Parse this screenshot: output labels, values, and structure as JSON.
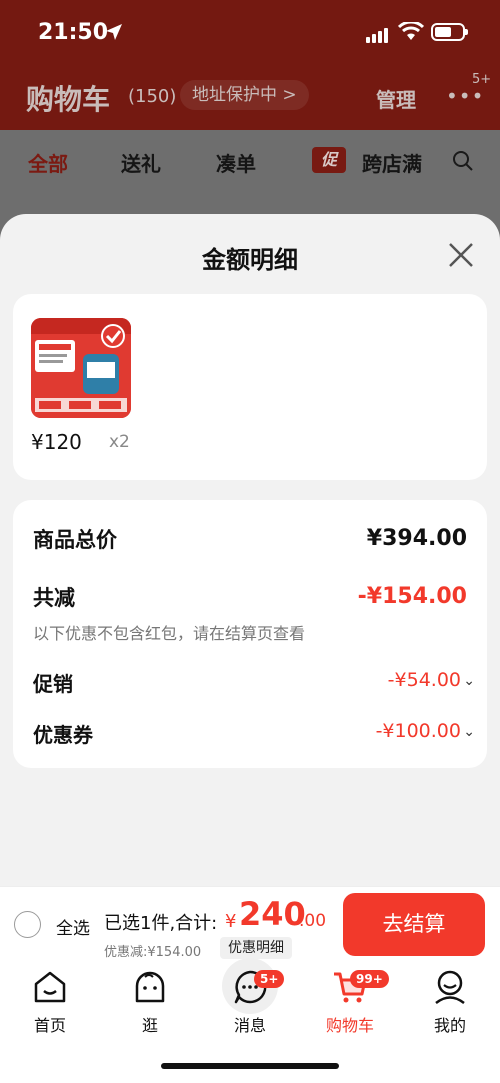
{
  "status_bar": {
    "time": "21:50"
  },
  "header": {
    "title": "购物车",
    "count": "(150)",
    "address_protect": "地址保护中 >",
    "manage": "管理",
    "more_badge": "5+"
  },
  "tabs": [
    "全部",
    "送礼",
    "凑单",
    "跨店满"
  ],
  "promo_chip": "促",
  "sheet": {
    "title": "金额明细",
    "item": {
      "price": "¥120",
      "qty": "x2"
    },
    "rows": {
      "total_label": "商品总价",
      "total_value": "¥394.00",
      "reduce_label": "共减",
      "reduce_value": "-¥154.00",
      "reduce_note": "以下优惠不包含红包，请在结算页查看",
      "promo_label": "促销",
      "promo_value": "-¥54.00",
      "coupon_label": "优惠券",
      "coupon_value": "-¥100.00"
    }
  },
  "checkout": {
    "select_all": "全选",
    "selected_summary": "已选1件,合计:",
    "yen": "¥",
    "total_int": "240",
    "total_dec": ".00",
    "discount_note": "优惠减:¥154.00",
    "detail_chip": "优惠明细",
    "button": "去结算"
  },
  "nav": [
    {
      "label": "首页",
      "icon": "home-icon"
    },
    {
      "label": "逛",
      "icon": "browse-icon"
    },
    {
      "label": "消息",
      "icon": "message-icon",
      "badge": "5+"
    },
    {
      "label": "购物车",
      "icon": "cart-icon",
      "badge": "99+"
    },
    {
      "label": "我的",
      "icon": "profile-icon"
    }
  ],
  "colors": {
    "accent": "#f2392b",
    "header_bg": "#741911"
  }
}
